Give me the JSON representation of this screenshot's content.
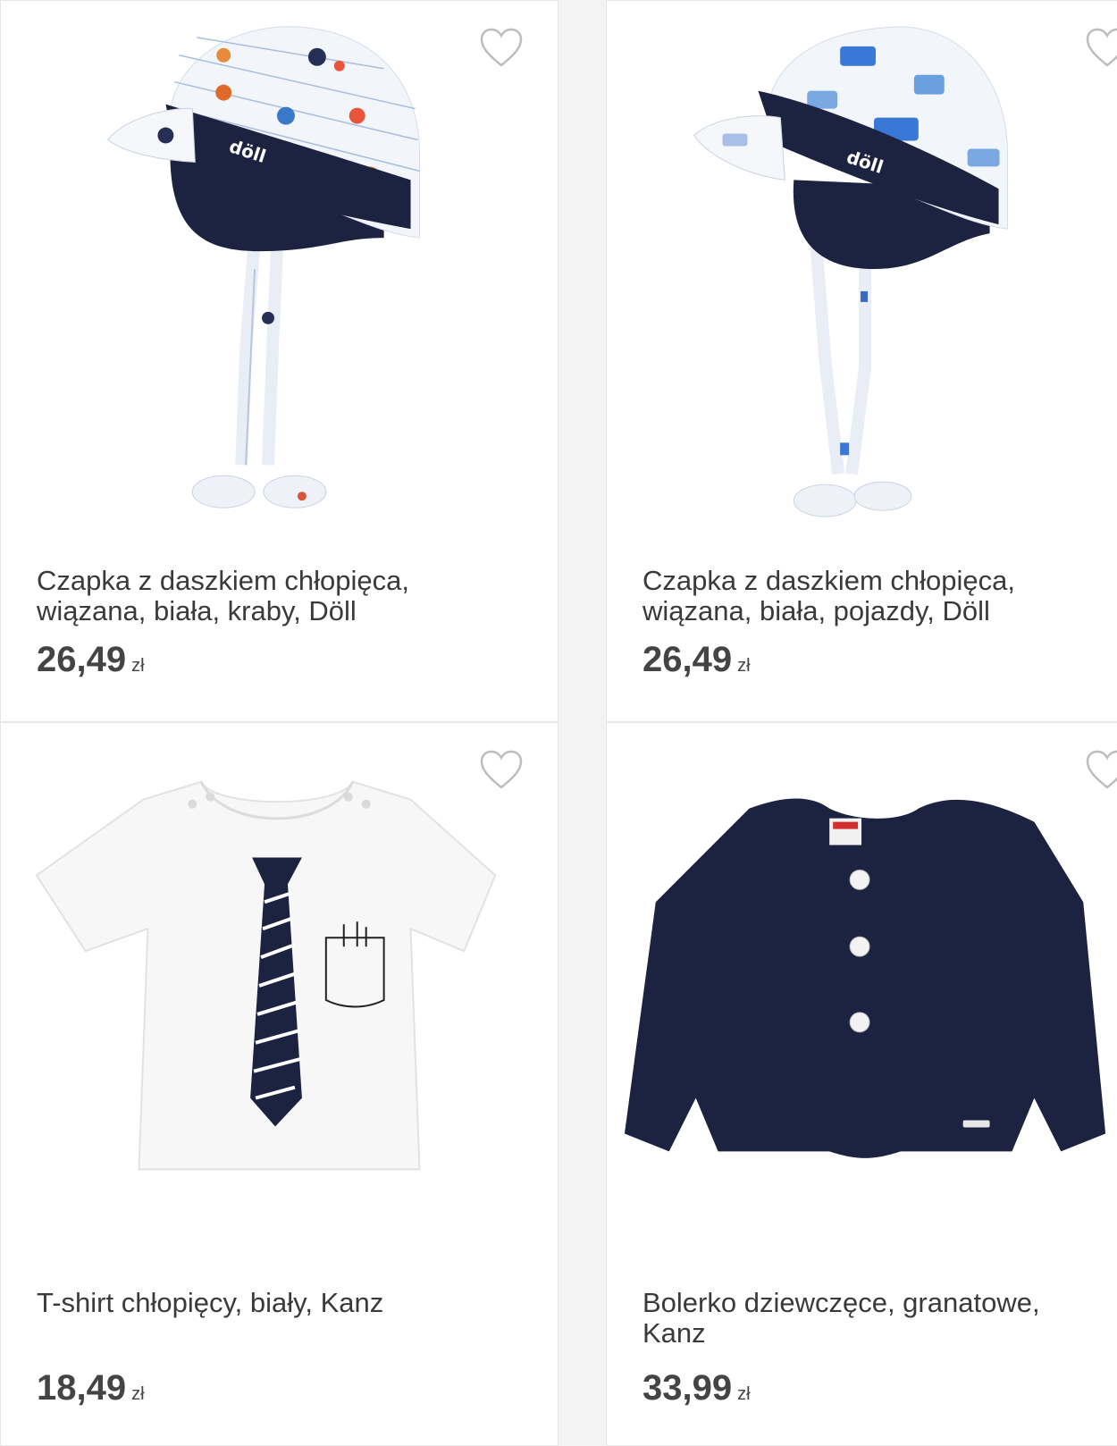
{
  "colors": {
    "navy": "#1b2340",
    "background": "#f3f3f3",
    "card": "#ffffff",
    "text": "#3a3a3a"
  },
  "products": [
    {
      "title": "Czapka z daszkiem chłopięca, wiązana, biała, kraby, Döll",
      "price": "26,49",
      "currency": "zł",
      "image": "cap-crabs-image",
      "logo_text": "döll"
    },
    {
      "title": "Czapka z daszkiem chłopięca, wiązana, biała, pojazdy, Döll",
      "price": "26,49",
      "currency": "zł",
      "image": "cap-vehicles-image",
      "logo_text": "döll"
    },
    {
      "title": "T-shirt chłopięcy, biały, Kanz",
      "price": "18,49",
      "currency": "zł",
      "image": "tshirt-tie-image"
    },
    {
      "title": "Bolerko dziewczęce, granatowe, Kanz",
      "price": "33,99",
      "currency": "zł",
      "image": "navy-bolero-image"
    }
  ],
  "icons": {
    "favorite": "heart-outline-icon"
  }
}
